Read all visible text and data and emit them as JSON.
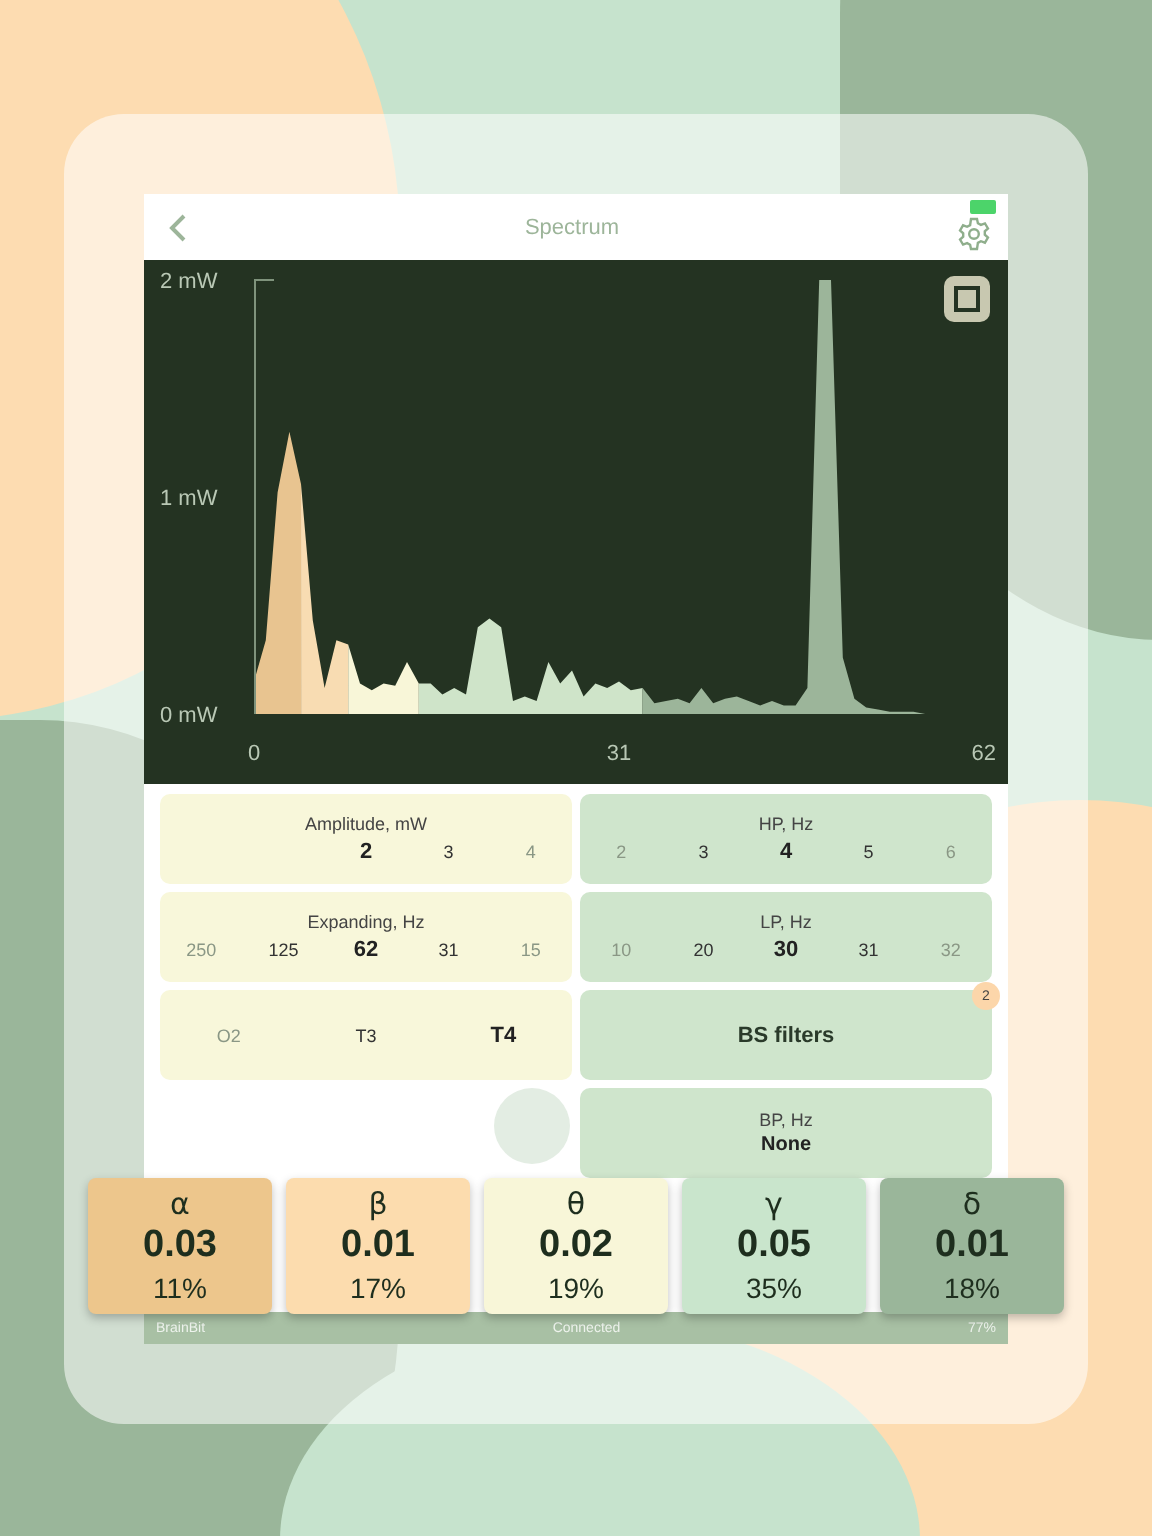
{
  "header": {
    "title": "Spectrum"
  },
  "spectrum": {
    "chart_data": {
      "type": "area",
      "xlim": [
        0,
        62
      ],
      "ylim": [
        0,
        2
      ],
      "xticks": [
        0,
        31,
        62
      ],
      "yticks": [
        {
          "value": 0,
          "label": "0 mW"
        },
        {
          "value": 1,
          "label": "1 mW"
        },
        {
          "value": 2,
          "label": "2 mW"
        }
      ],
      "x": [
        0,
        1,
        2,
        3,
        4,
        5,
        6,
        7,
        8,
        9,
        10,
        11,
        12,
        13,
        14,
        15,
        16,
        17,
        18,
        19,
        20,
        21,
        22,
        23,
        24,
        25,
        26,
        27,
        28,
        29,
        30,
        31,
        32,
        33,
        34,
        35,
        36,
        37,
        38,
        39,
        40,
        41,
        42,
        43,
        44,
        45,
        46,
        47,
        48,
        49,
        50,
        51,
        52,
        53,
        54,
        55,
        56,
        57,
        58,
        59,
        60,
        61,
        62
      ],
      "series": [
        {
          "color": "#e8c490",
          "values": [
            0.15,
            0.34,
            1.02,
            1.3,
            1.06,
            null,
            null,
            null,
            null,
            null,
            null,
            null,
            null,
            null,
            null,
            null,
            null,
            null,
            null,
            null,
            null,
            null,
            null,
            null,
            null,
            null,
            null,
            null,
            null,
            null,
            null,
            null,
            null,
            null,
            null,
            null,
            null,
            null,
            null,
            null,
            null,
            null,
            null,
            null,
            null,
            null,
            null,
            null,
            null,
            null,
            null,
            null,
            null,
            null,
            null,
            null,
            null,
            null,
            null,
            null,
            null,
            null,
            null
          ]
        },
        {
          "color": "#f8dcb2",
          "values": [
            null,
            null,
            null,
            null,
            1.06,
            0.43,
            0.12,
            0.34,
            0.32,
            null,
            null,
            null,
            null,
            null,
            null,
            null,
            null,
            null,
            null,
            null,
            null,
            null,
            null,
            null,
            null,
            null,
            null,
            null,
            null,
            null,
            null,
            null,
            null,
            null,
            null,
            null,
            null,
            null,
            null,
            null,
            null,
            null,
            null,
            null,
            null,
            null,
            null,
            null,
            null,
            null,
            null,
            null,
            null,
            null,
            null,
            null,
            null,
            null,
            null,
            null,
            null,
            null,
            null
          ]
        },
        {
          "color": "#f8f6d8",
          "values": [
            null,
            null,
            null,
            null,
            null,
            null,
            null,
            null,
            0.32,
            0.14,
            0.11,
            0.14,
            0.13,
            0.24,
            0.14,
            null,
            null,
            null,
            null,
            null,
            null,
            null,
            null,
            null,
            null,
            null,
            null,
            null,
            null,
            null,
            null,
            null,
            null,
            null,
            null,
            null,
            null,
            null,
            null,
            null,
            null,
            null,
            null,
            null,
            null,
            null,
            null,
            null,
            null,
            null,
            null,
            null,
            null,
            null,
            null,
            null,
            null,
            null,
            null,
            null,
            null,
            null,
            null
          ]
        },
        {
          "color": "#cfe4c9",
          "values": [
            null,
            null,
            null,
            null,
            null,
            null,
            null,
            null,
            null,
            null,
            null,
            null,
            null,
            null,
            0.14,
            0.14,
            0.09,
            0.12,
            0.09,
            0.4,
            0.44,
            0.4,
            0.06,
            0.08,
            0.06,
            0.24,
            0.14,
            0.2,
            0.08,
            0.14,
            0.12,
            0.15,
            0.11,
            0.12,
            null,
            null,
            null,
            null,
            null,
            null,
            null,
            null,
            null,
            null,
            null,
            null,
            null,
            null,
            null,
            null,
            null,
            null,
            null,
            null,
            null,
            null,
            null,
            null,
            null,
            null,
            null,
            null,
            null
          ]
        },
        {
          "color": "#9cb59a",
          "values": [
            null,
            null,
            null,
            null,
            null,
            null,
            null,
            null,
            null,
            null,
            null,
            null,
            null,
            null,
            null,
            null,
            null,
            null,
            null,
            null,
            null,
            null,
            null,
            null,
            null,
            null,
            null,
            null,
            null,
            null,
            null,
            null,
            null,
            0.12,
            0.05,
            0.06,
            0.07,
            0.05,
            0.12,
            0.05,
            0.07,
            0.08,
            0.06,
            0.04,
            0.06,
            0.04,
            0.04,
            0.12,
            2,
            2,
            0.26,
            0.07,
            0.03,
            0.02,
            0.01,
            0.01,
            0.01,
            0,
            0,
            0,
            0,
            0,
            0
          ]
        }
      ]
    }
  },
  "settings": [
    {
      "kind": "selector",
      "title": "Amplitude, mW",
      "color": "#f8f7da",
      "options": [
        {
          "label": "2",
          "selected": true,
          "dimmed": false
        },
        {
          "label": "3",
          "selected": false,
          "dimmed": false
        },
        {
          "label": "4",
          "selected": false,
          "dimmed": true
        }
      ]
    },
    {
      "kind": "selector",
      "title": "HP, Hz",
      "color": "#cfe5cc",
      "options": [
        {
          "label": "2",
          "selected": false,
          "dimmed": true
        },
        {
          "label": "3",
          "selected": false,
          "dimmed": false
        },
        {
          "label": "4",
          "selected": true,
          "dimmed": false
        },
        {
          "label": "5",
          "selected": false,
          "dimmed": false
        },
        {
          "label": "6",
          "selected": false,
          "dimmed": true
        }
      ]
    },
    {
      "kind": "selector",
      "title": "Expanding, Hz",
      "color": "#f8f7da",
      "options": [
        {
          "label": "250",
          "selected": false,
          "dimmed": true
        },
        {
          "label": "125",
          "selected": false,
          "dimmed": false
        },
        {
          "label": "62",
          "selected": true,
          "dimmed": false
        },
        {
          "label": "31",
          "selected": false,
          "dimmed": false
        },
        {
          "label": "15",
          "selected": false,
          "dimmed": true
        }
      ]
    },
    {
      "kind": "selector",
      "title": "LP, Hz",
      "color": "#cfe5cc",
      "options": [
        {
          "label": "10",
          "selected": false,
          "dimmed": true
        },
        {
          "label": "20",
          "selected": false,
          "dimmed": false
        },
        {
          "label": "30",
          "selected": true,
          "dimmed": false
        },
        {
          "label": "31",
          "selected": false,
          "dimmed": false
        },
        {
          "label": "32",
          "selected": false,
          "dimmed": true
        }
      ]
    },
    {
      "kind": "selector",
      "color": "#f8f7da",
      "options": [
        {
          "label": "O2",
          "selected": false,
          "dimmed": true
        },
        {
          "label": "T3",
          "selected": false,
          "dimmed": false
        },
        {
          "label": "T4",
          "selected": true,
          "dimmed": false
        }
      ]
    },
    {
      "kind": "button",
      "label": "BS filters",
      "badge": "2",
      "color": "#cfe5cc"
    },
    {
      "kind": "value",
      "title": "BP, Hz",
      "value": "None",
      "color": "#cfe5cc"
    }
  ],
  "bands": [
    {
      "symbol": "α",
      "value": "0.03",
      "percent": "11%",
      "color": "#edc68c"
    },
    {
      "symbol": "β",
      "value": "0.01",
      "percent": "17%",
      "color": "#fcdcae"
    },
    {
      "symbol": "θ",
      "value": "0.02",
      "percent": "19%",
      "color": "#f8f6d8"
    },
    {
      "symbol": "γ",
      "value": "0.05",
      "percent": "35%",
      "color": "#c9e5cc"
    },
    {
      "symbol": "δ",
      "value": "0.01",
      "percent": "18%",
      "color": "#9ab69a"
    }
  ],
  "status_bar": {
    "device": "BrainBit",
    "state": "Connected",
    "battery": "77%"
  }
}
